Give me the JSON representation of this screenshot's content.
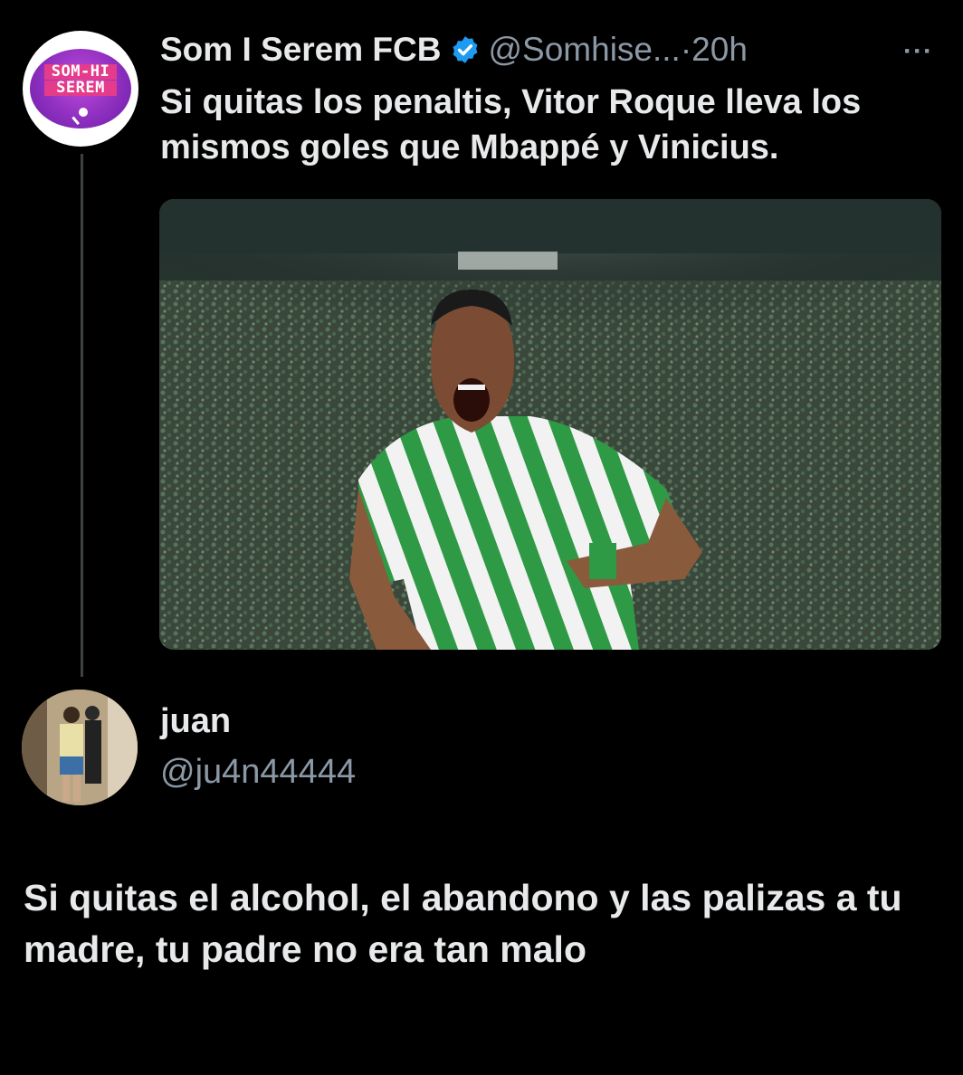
{
  "tweet": {
    "display_name": "Som I Serem FCB",
    "handle": "@Somhise...",
    "separator_time": "·20h",
    "more": "···",
    "text": "Si quitas los penaltis, Vitor Roque lleva los mismos goles que Mbappé y Vinicius.",
    "avatar_text_line1": "SOM-HI",
    "avatar_text_line2": "SEREM",
    "verified_color": "#1d9bf0",
    "media_icon": "photo-of-player-celebrating"
  },
  "reply": {
    "display_name": "juan",
    "handle": "@ju4n44444",
    "text": "Si quitas el alcohol, el abandono y las palizas a tu madre, tu padre no era tan malo"
  },
  "colors": {
    "background": "#000000",
    "text": "#e7e9ea",
    "secondary": "#8b98a5",
    "thread_line": "#3e4144"
  }
}
